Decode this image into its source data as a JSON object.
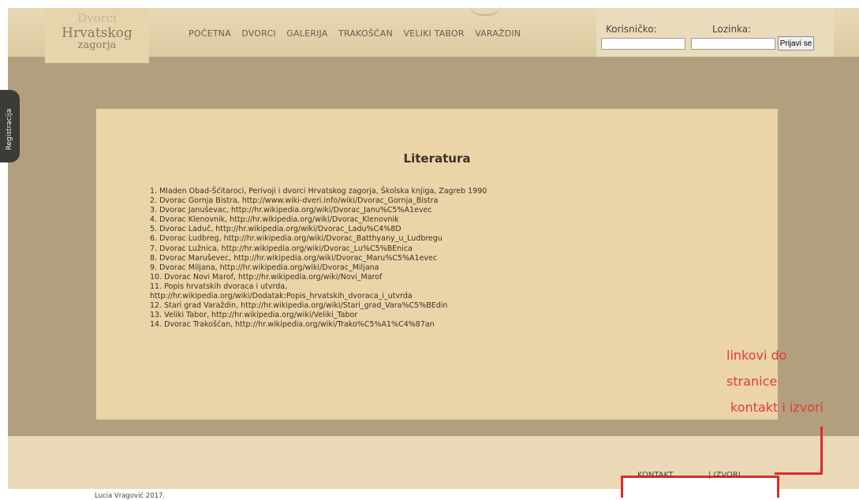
{
  "logo": {
    "line1": "Dvorci",
    "line2": "Hrvatskog",
    "line3": "zagorja"
  },
  "nav": {
    "items": [
      "POČETNA",
      "DVORCI",
      "GALERIJA",
      "TRAKOŠĆAN",
      "VELIKI TABOR",
      "VARAŽDIN"
    ]
  },
  "login": {
    "username_label": "Korisničko:",
    "password_label": "Lozinka:",
    "submit": "Prijavi se"
  },
  "side_tab": {
    "label": "Registracija"
  },
  "content": {
    "title": "Literatura",
    "references": [
      "1. Mladen Obad-Šćitaroci, Perivoji i dvorci Hrvatskog zagorja, Školska knjiga, Zagreb 1990",
      "2. Dvorac Gornja Bistra, http://www.wiki-dveri.info/wiki/Dvorac_Gornja_Bistra",
      "3. Dvorac Januševac, http://hr.wikipedia.org/wiki/Dvorac_Janu%C5%A1evec",
      "4. Dvorac Klenovnik, http://hr.wikipedia.org/wiki/Dvorac_Klenovnik",
      "5. Dvorac Laduč, http://hr.wikipedia.org/wiki/Dvorac_Ladu%C4%8D",
      "6. Dvorac Ludbreg, http://hr.wikipedia.org/wiki/Dvorac_Batthyany_u_Ludbregu",
      "7. Dvorac Lužnica, http://hr.wikipedia.org/wiki/Dvorac_Lu%C5%BEnica",
      "8. Dvorac Maruševec, http://hr.wikipedia.org/wiki/Dvorac_Maru%C5%A1evec",
      "9. Dvorac Miljana, http://hr.wikipedia.org/wiki/Dvorac_Miljana",
      "10. Dvorac Novi Marof, http://hr.wikipedia.org/wiki/Novi_Marof",
      "11. Popis hrvatskih dvoraca i utvrda,",
      "http://hr.wikipedia.org/wiki/Dodatak:Popis_hrvatskih_dvoraca_i_utvrda",
      "12. Stari grad Varaždin, http://hr.wikipedia.org/wiki/Stari_grad_Vara%C5%BEdin",
      "13. Veliki Tabor, http://hr.wikipedia.org/wiki/Veliki_Tabor",
      "14. Dvorac Trakošćan, http://hr.wikipedia.org/wiki/Trako%C5%A1%C4%87an"
    ]
  },
  "footer": {
    "copyright": "Lucia Vragović 2017.",
    "contact": "KONTAKT",
    "sources": "| IZVORI"
  },
  "annotation": {
    "line1": "linkovi do",
    "line2": "stranice",
    "line3": "kontakt i izvori"
  },
  "colors": {
    "page_background": "#b19f7d",
    "content_panel": "#ead4a8",
    "annotation_red": "#dd2b2b"
  }
}
